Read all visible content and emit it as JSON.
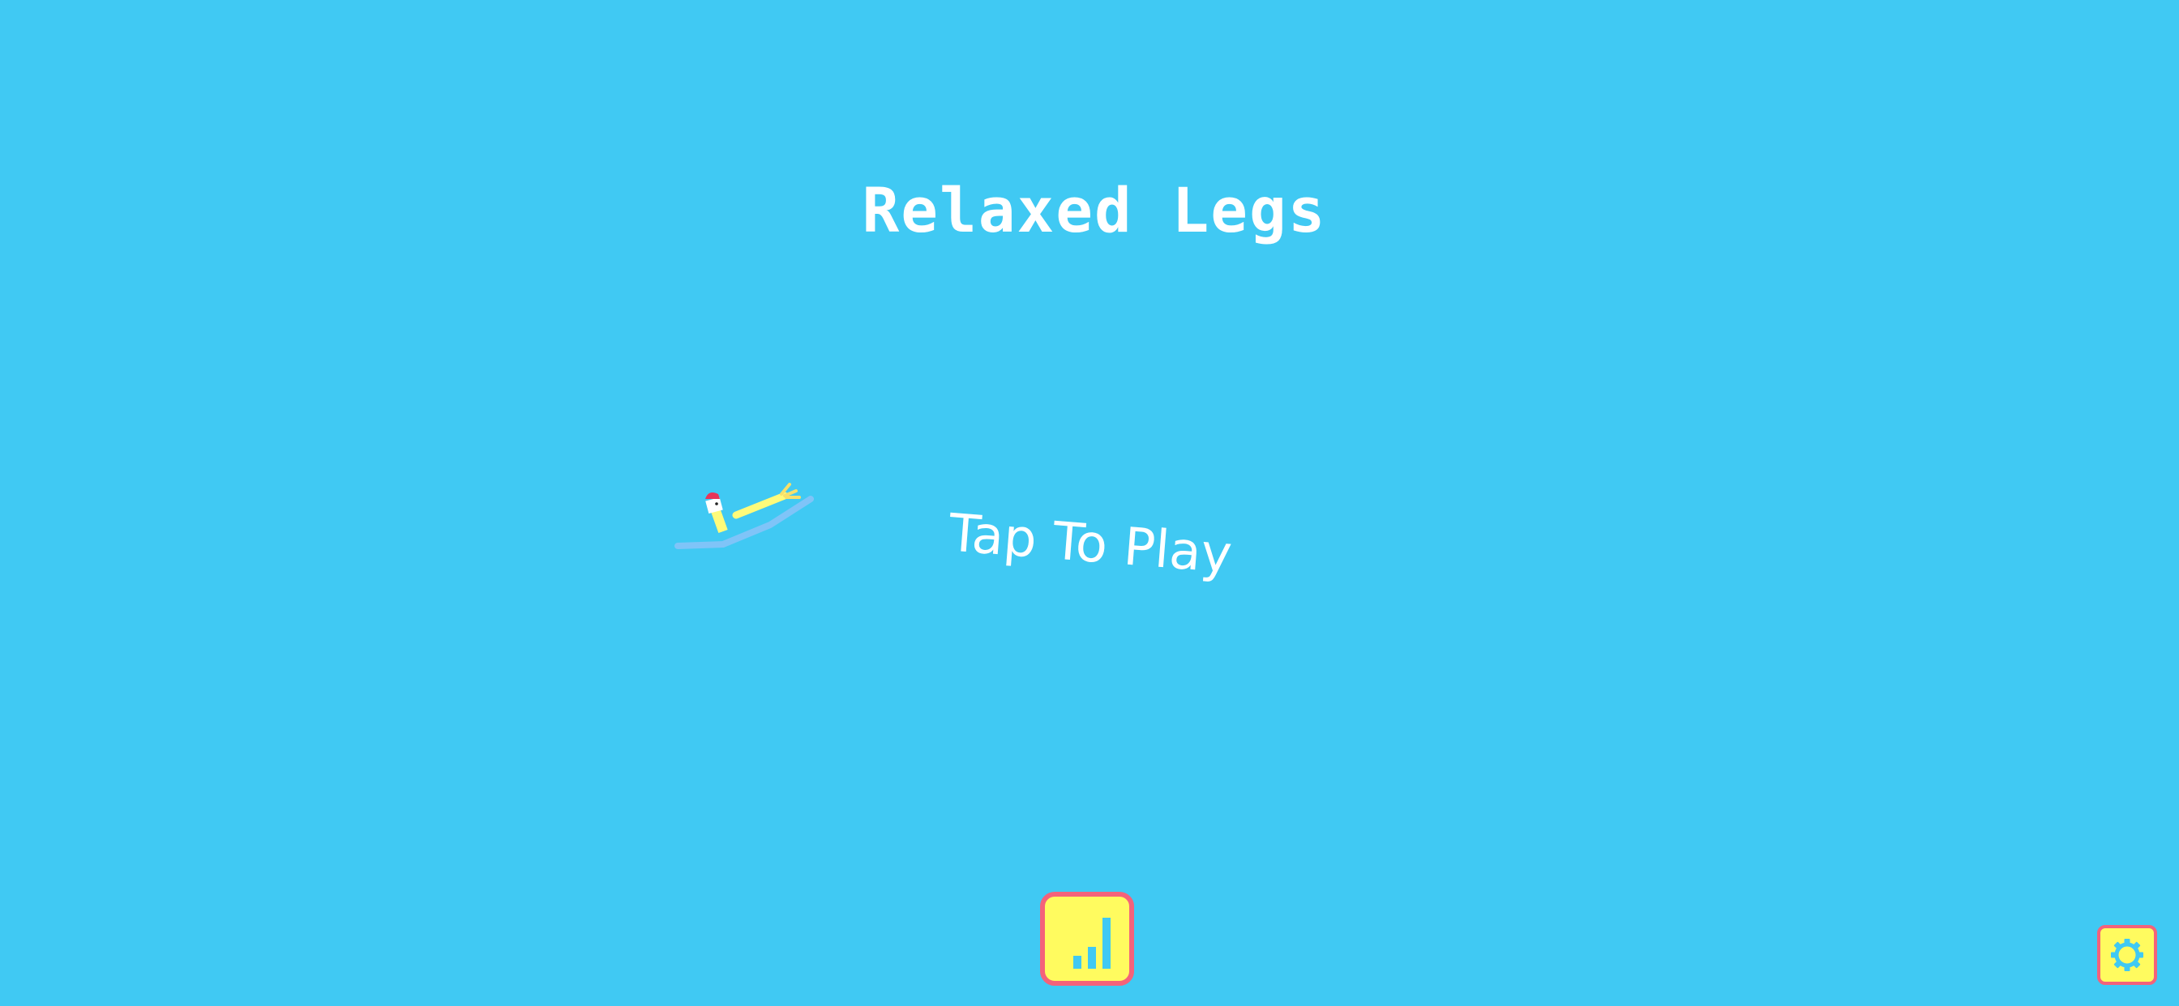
{
  "game": {
    "title": "Relaxed Legs",
    "prompt": "Tap To Play"
  },
  "icons": {
    "stats": "bar-chart-icon",
    "settings": "gear-icon"
  },
  "colors": {
    "background": "#40c9f3",
    "button_fill": "#fffb5f",
    "button_border": "#f4627a",
    "icon_color": "#40c9f3",
    "text": "#ffffff"
  }
}
